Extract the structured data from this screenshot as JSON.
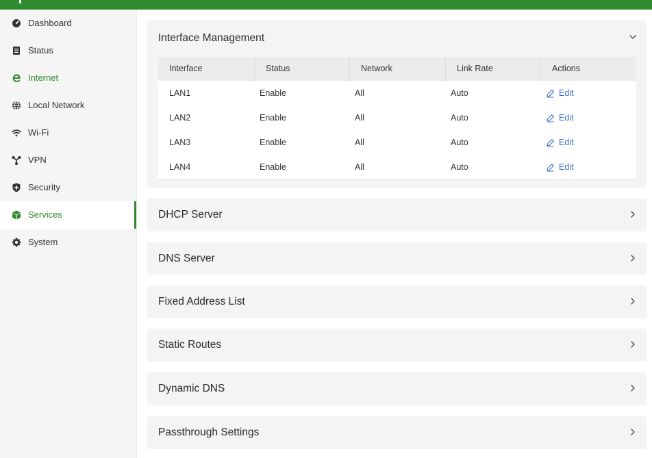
{
  "sidebar": {
    "items": [
      {
        "label": "Dashboard",
        "icon": "dashboard-gauge-icon"
      },
      {
        "label": "Status",
        "icon": "list-document-icon"
      },
      {
        "label": "Internet",
        "icon": "internet-explorer-icon"
      },
      {
        "label": "Local Network",
        "icon": "globe-icon"
      },
      {
        "label": "Wi-Fi",
        "icon": "wifi-icon"
      },
      {
        "label": "VPN",
        "icon": "vpn-network-icon"
      },
      {
        "label": "Security",
        "icon": "shield-icon"
      },
      {
        "label": "Services",
        "icon": "cube-icon"
      },
      {
        "label": "System",
        "icon": "gear-icon"
      }
    ],
    "active": "Services",
    "highlighted": "Internet"
  },
  "interface_panel": {
    "title": "Interface Management",
    "columns": [
      "Interface",
      "Status",
      "Network",
      "Link Rate",
      "Actions"
    ],
    "rows": [
      {
        "interface": "LAN1",
        "status": "Enable",
        "network": "All",
        "link_rate": "Auto",
        "action": "Edit"
      },
      {
        "interface": "LAN2",
        "status": "Enable",
        "network": "All",
        "link_rate": "Auto",
        "action": "Edit"
      },
      {
        "interface": "LAN3",
        "status": "Enable",
        "network": "All",
        "link_rate": "Auto",
        "action": "Edit"
      },
      {
        "interface": "LAN4",
        "status": "Enable",
        "network": "All",
        "link_rate": "Auto",
        "action": "Edit"
      }
    ]
  },
  "collapsed_panels": [
    {
      "title": "DHCP Server"
    },
    {
      "title": "DNS Server"
    },
    {
      "title": "Fixed Address List"
    },
    {
      "title": "Static Routes"
    },
    {
      "title": "Dynamic DNS"
    },
    {
      "title": "Passthrough Settings"
    }
  ],
  "colors": {
    "brand_green": "#2e8b2e",
    "link_blue": "#3e6dc6"
  }
}
